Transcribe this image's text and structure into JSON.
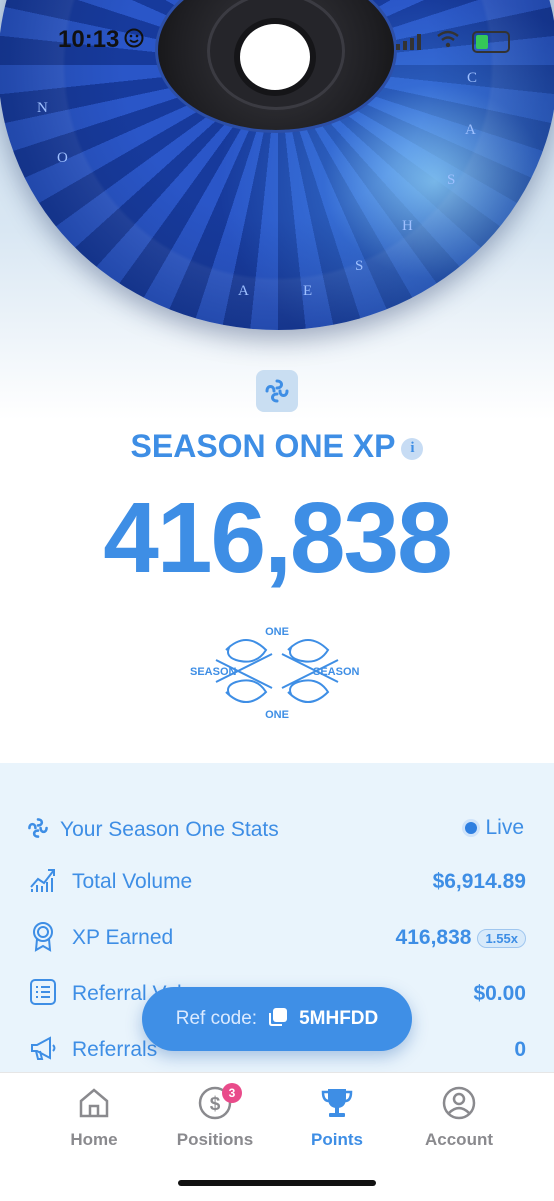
{
  "status_bar": {
    "time": "10:13"
  },
  "disc": {
    "letters": [
      "C",
      "A",
      "S",
      "H",
      "S",
      "E",
      "A",
      "O",
      "N"
    ]
  },
  "season": {
    "title": "SEASON ONE XP",
    "info_label": "i",
    "xp_value": "416,838",
    "emblem": {
      "top": "ONE",
      "bottom": "ONE",
      "left": "SEASON",
      "right": "SEASON"
    }
  },
  "stats": {
    "header": "Your Season One Stats",
    "live_label": "Live",
    "rows": [
      {
        "label": "Total Volume",
        "value": "$6,914.89",
        "icon": "chart-trend-icon"
      },
      {
        "label": "XP Earned",
        "value": "416,838",
        "multiplier": "1.55x",
        "icon": "award-ribbon-icon"
      },
      {
        "label": "Referral Volume",
        "value": "$0.00",
        "icon": "list-document-icon"
      },
      {
        "label": "Referrals",
        "value": "0",
        "icon": "megaphone-icon"
      }
    ]
  },
  "ref_code": {
    "label": "Ref code:",
    "value": "5MHFDD"
  },
  "tabs": [
    {
      "label": "Home",
      "icon": "home-icon",
      "active": false
    },
    {
      "label": "Positions",
      "icon": "dollar-icon",
      "badge": "3",
      "active": false
    },
    {
      "label": "Points",
      "icon": "trophy-icon",
      "active": true
    },
    {
      "label": "Account",
      "icon": "account-icon",
      "active": false
    }
  ],
  "colors": {
    "accent": "#3e8ee5",
    "stats_bg": "#e9f4fc",
    "badge": "#e94b8a",
    "inactive_tab": "#8a8a8e"
  }
}
